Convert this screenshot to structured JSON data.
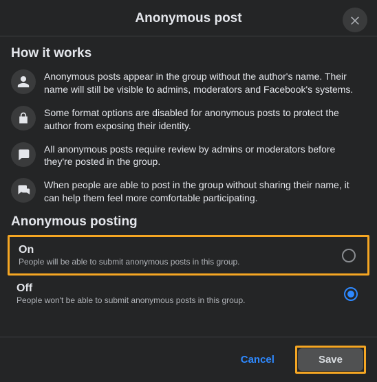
{
  "header": {
    "title": "Anonymous post"
  },
  "howItWorks": {
    "title": "How it works",
    "items": [
      "Anonymous posts appear in the group without the author's name. Their name will still be visible to admins, moderators and Facebook's systems.",
      "Some format options are disabled for anonymous posts to protect the author from exposing their identity.",
      "All anonymous posts require review by admins or moderators before they're posted in the group.",
      "When people are able to post in the group without sharing their name, it can help them feel more comfortable participating."
    ]
  },
  "posting": {
    "title": "Anonymous posting",
    "on": {
      "label": "On",
      "desc": "People will be able to submit anonymous posts in this group."
    },
    "off": {
      "label": "Off",
      "desc": "People won't be able to submit anonymous posts in this group."
    }
  },
  "footer": {
    "cancel": "Cancel",
    "save": "Save"
  }
}
